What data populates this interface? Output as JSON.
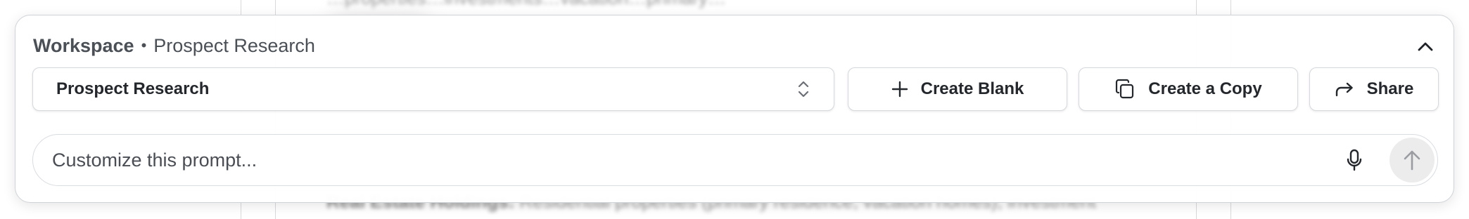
{
  "background": {
    "top_text": "…properties…investments…vacation…primary…",
    "bottom_label": "Real Estate Holdings:",
    "bottom_text": "Residential properties (primary residence, vacation homes), investment"
  },
  "breadcrumb": {
    "root": "Workspace",
    "separator": "•",
    "current": "Prospect Research"
  },
  "selector": {
    "value": "Prospect Research"
  },
  "actions": {
    "create_blank": "Create Blank",
    "create_copy": "Create a Copy",
    "share": "Share"
  },
  "prompt": {
    "placeholder": "Customize this prompt..."
  },
  "icons": {
    "collapse": "chevron-up-icon",
    "selector": "up-down-chevron-icon",
    "create_blank": "plus-icon",
    "create_copy": "copy-icon",
    "share": "share-arrow-icon",
    "mic": "microphone-icon",
    "send": "arrow-up-icon"
  },
  "colors": {
    "panel_border": "#cfd2d6",
    "text_primary": "#24272b",
    "send_button_bg": "#ececed",
    "send_icon": "#9a9ca1"
  }
}
